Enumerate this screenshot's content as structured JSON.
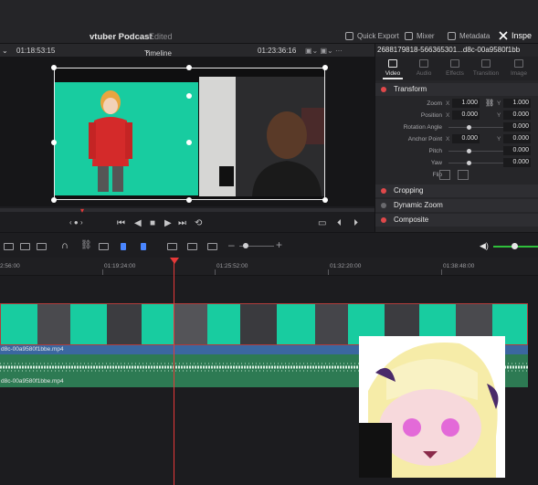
{
  "app": {
    "project_title": "vtuber Podcast",
    "project_status": "Edited",
    "top_tools": [
      "Quick Export",
      "Mixer",
      "Metadata"
    ],
    "inspector_label": "Inspe"
  },
  "viewer": {
    "source_timecode": "01:18:53:15",
    "timeline_name": "Timeline 1",
    "record_timecode": "01:23:36:16"
  },
  "inspector": {
    "clip_name": "2688179818-566365301...d8c-00a9580f1bb",
    "tabs": [
      "Video",
      "Audio",
      "Effects",
      "Transition",
      "Image"
    ],
    "sections": [
      "Transform",
      "Cropping",
      "Dynamic Zoom",
      "Composite"
    ],
    "params": {
      "zoom_label": "Zoom",
      "zoom_x": "1.000",
      "zoom_y": "1.000",
      "position_label": "Position",
      "position_x": "0.000",
      "position_y": "0.000",
      "rotation_label": "Rotation Angle",
      "rotation_val": "0.000",
      "anchor_label": "Anchor Point",
      "anchor_x": "0.000",
      "anchor_y": "0.000",
      "pitch_label": "Pitch",
      "pitch_val": "0.000",
      "yaw_label": "Yaw",
      "yaw_val": "0.000",
      "flip_label": "Flip",
      "axis_x": "X",
      "axis_y": "Y"
    }
  },
  "timeline": {
    "ruler_ticks": [
      "2:56:00",
      "01:19:24:00",
      "01:25:52:00",
      "01:32:20:00",
      "01:38:48:00"
    ],
    "video_clip_name": "d8c-00a9580f1bbe.mp4",
    "audio_clip_name": "d8c-00a9580f1bbe.mp4"
  },
  "colors": {
    "accent_red": "#e63939",
    "video_track_blue": "#3b67a0",
    "audio_track_green": "#2d7a53",
    "greenscreen": "#18cca0"
  }
}
